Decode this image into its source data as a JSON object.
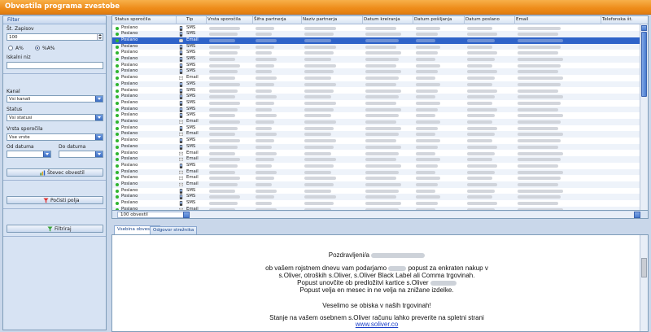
{
  "window": {
    "title": "Obvestila programa zvestobe"
  },
  "filter": {
    "header": "Filter",
    "records_label": "Št. Zapisov",
    "records_value": "100",
    "radio_a": "A%",
    "radio_b": "%A%",
    "search_label": "Iskalni niz",
    "search_value": "",
    "channel_label": "Kanal",
    "channel_value": "Vsi kanali",
    "status_label": "Status",
    "status_value": "Vsi statusi",
    "type_label": "Vrsta sporočila",
    "type_value": "Vse vrste",
    "date_from_label": "Od datuma",
    "date_to_label": "Do datuma",
    "btn_count": "Števec obvestil",
    "btn_clear": "Počisti polja",
    "btn_filter": "Filtriraj"
  },
  "grid": {
    "columns": [
      "Status sporočila",
      "Tip",
      "Vrsta sporočila",
      "Šifra partnerja",
      "Naziv partnerja",
      "Datum kreiranja",
      "Datum pošiljanja",
      "Datum poslano",
      "Email",
      "Telefonska št."
    ],
    "rows": [
      {
        "status": "Poslano",
        "type": "SMS"
      },
      {
        "status": "Poslano",
        "type": "SMS"
      },
      {
        "status": "Poslano",
        "type": "Email"
      },
      {
        "status": "Poslano",
        "type": "SMS"
      },
      {
        "status": "Poslano",
        "type": "SMS"
      },
      {
        "status": "Poslano",
        "type": "SMS"
      },
      {
        "status": "Poslano",
        "type": "SMS"
      },
      {
        "status": "Poslano",
        "type": "SMS"
      },
      {
        "status": "Poslano",
        "type": "Email"
      },
      {
        "status": "Poslano",
        "type": "SMS"
      },
      {
        "status": "Poslano",
        "type": "SMS"
      },
      {
        "status": "Poslano",
        "type": "SMS"
      },
      {
        "status": "Poslano",
        "type": "SMS"
      },
      {
        "status": "Poslano",
        "type": "SMS"
      },
      {
        "status": "Poslano",
        "type": "SMS"
      },
      {
        "status": "Poslano",
        "type": "Email"
      },
      {
        "status": "Poslano",
        "type": "SMS"
      },
      {
        "status": "Poslano",
        "type": "Email"
      },
      {
        "status": "Poslano",
        "type": "SMS"
      },
      {
        "status": "Poslano",
        "type": "SMS"
      },
      {
        "status": "Poslano",
        "type": "Email"
      },
      {
        "status": "Poslano",
        "type": "Email"
      },
      {
        "status": "Poslano",
        "type": "SMS"
      },
      {
        "status": "Poslano",
        "type": "Email"
      },
      {
        "status": "Poslano",
        "type": "Email"
      },
      {
        "status": "Poslano",
        "type": "Email"
      },
      {
        "status": "Poslano",
        "type": "SMS"
      },
      {
        "status": "Poslano",
        "type": "SMS"
      },
      {
        "status": "Poslano",
        "type": "SMS"
      },
      {
        "status": "Poslano",
        "type": "Email"
      }
    ],
    "selected_row": 2,
    "row_count": "100 obvestil"
  },
  "tabs": [
    "Vsebina obvestila",
    "Odgovor strežnika"
  ],
  "message": {
    "greeting": "Pozdravljeni/a",
    "line1_a": "ob vašem rojstnem dnevu vam podarjamo",
    "line1_b": "popust za enkraten nakup v",
    "line2": "s.Oliver, otroških s.Oliver, s.Oliver Black Label ali Comma trgovinah.",
    "line3_a": "Popust unovčite ob predložitvi kartice s.Oliver",
    "line4": "Popust velja en mesec in ne velja na znižane izdelke.",
    "line5": "Veselimo se obiska v naših trgovinah!",
    "line6": "Stanje na vašem osebnem s.Oliver računu lahko preverite na spletni strani",
    "link": "www.soliver.co"
  },
  "colors": {
    "title_bar": "#ee8c1a",
    "selection": "#2e63c9",
    "status_ok": "#2fb52f",
    "panel": "#d7e3f3"
  }
}
